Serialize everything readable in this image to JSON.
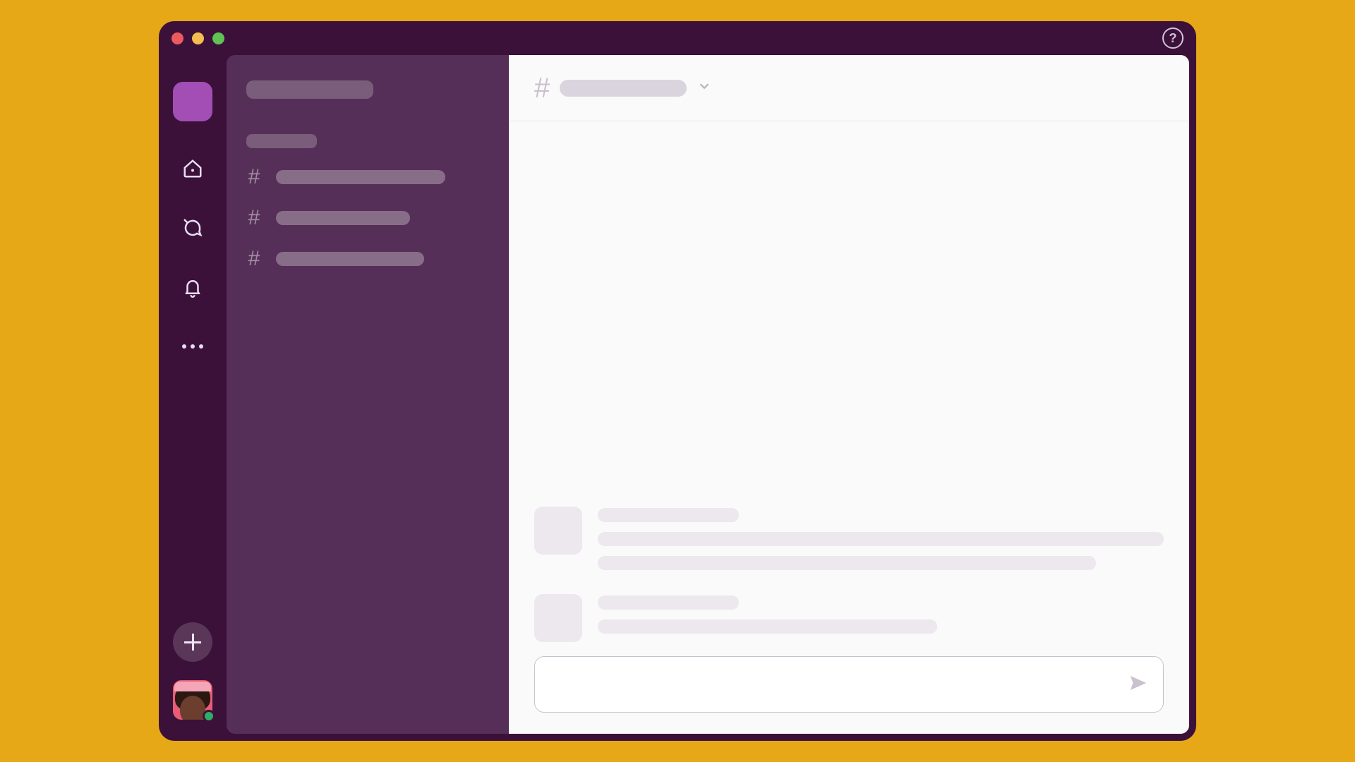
{
  "window": {
    "traffic_lights": {
      "close": "red",
      "minimize": "yellow",
      "zoom": "green"
    },
    "help_label": "?"
  },
  "rail": {
    "items": [
      {
        "name": "workspace-tile",
        "interactable": true
      },
      {
        "name": "home-icon",
        "interactable": true
      },
      {
        "name": "dms-icon",
        "interactable": true
      },
      {
        "name": "activity-icon",
        "interactable": true
      },
      {
        "name": "more-icon",
        "interactable": true
      }
    ],
    "compose_button": "compose",
    "user": {
      "presence": "active"
    }
  },
  "sidebar": {
    "workspace_name_placeholder": "",
    "section_label_placeholder": "",
    "channels": [
      {
        "prefix": "#",
        "name_placeholder": "",
        "width": "cw1"
      },
      {
        "prefix": "#",
        "name_placeholder": "",
        "width": "cw2"
      },
      {
        "prefix": "#",
        "name_placeholder": "",
        "width": "cw3"
      }
    ]
  },
  "main": {
    "header": {
      "prefix": "#",
      "channel_name_placeholder": ""
    },
    "messages": [
      {
        "author_placeholder": "",
        "lines": [
          "full",
          "w90"
        ]
      },
      {
        "author_placeholder": "",
        "lines": [
          "w70"
        ]
      }
    ],
    "composer": {
      "placeholder": "",
      "send_label": "Send"
    }
  },
  "colors": {
    "page_bg": "#E6A817",
    "window_bg": "#3B1139",
    "sidebar_bg": "#552F57",
    "accent": "#A24EB4",
    "presence_active": "#2FAC66"
  }
}
